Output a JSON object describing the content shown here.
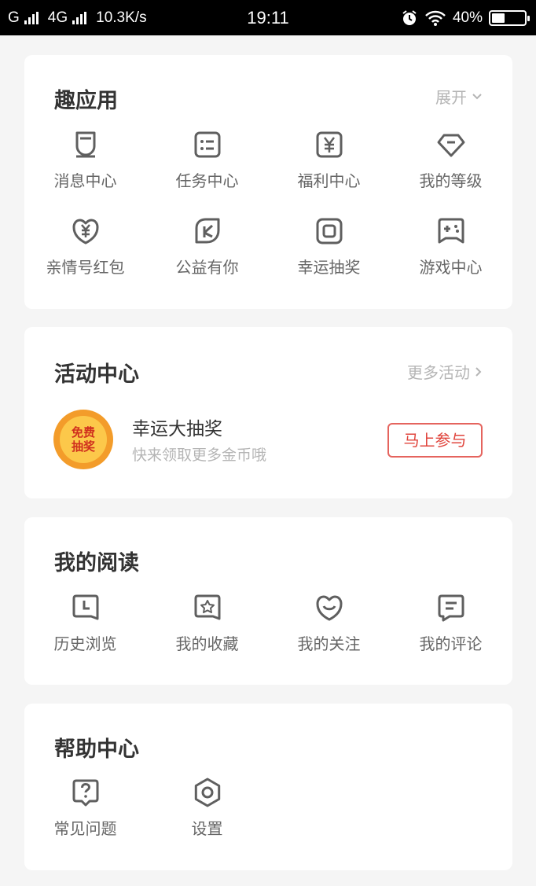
{
  "status_bar": {
    "signal1_label": "G",
    "signal2_label": "4G",
    "net_speed": "10.3K/s",
    "time": "19:11",
    "battery": "40%",
    "battery_level": 0.4,
    "icons": [
      "signal-bars-icon",
      "alarm-icon",
      "wifi-icon",
      "battery-icon"
    ]
  },
  "fun_apps": {
    "title": "趣应用",
    "expand_label": "展开",
    "items": [
      {
        "label": "消息中心",
        "icon": "bell-icon"
      },
      {
        "label": "任务中心",
        "icon": "task-list-icon"
      },
      {
        "label": "福利中心",
        "icon": "yuan-box-icon"
      },
      {
        "label": "我的等级",
        "icon": "diamond-icon"
      },
      {
        "label": "亲情号红包",
        "icon": "yuan-heart-icon"
      },
      {
        "label": "公益有你",
        "icon": "leaf-icon"
      },
      {
        "label": "幸运抽奖",
        "icon": "lucky-box-icon"
      },
      {
        "label": "游戏中心",
        "icon": "gamepad-icon"
      }
    ]
  },
  "activity": {
    "title": "活动中心",
    "more_label": "更多活动",
    "badge_line1": "免费",
    "badge_line2": "抽奖",
    "promo_title": "幸运大抽奖",
    "promo_subtitle": "快来领取更多金币哦",
    "join_label": "马上参与"
  },
  "reading": {
    "title": "我的阅读",
    "items": [
      {
        "label": "历史浏览",
        "icon": "clock-icon"
      },
      {
        "label": "我的收藏",
        "icon": "star-icon"
      },
      {
        "label": "我的关注",
        "icon": "smile-heart-icon"
      },
      {
        "label": "我的评论",
        "icon": "comment-icon"
      }
    ]
  },
  "help": {
    "title": "帮助中心",
    "items": [
      {
        "label": "常见问题",
        "icon": "question-icon"
      },
      {
        "label": "设置",
        "icon": "settings-icon"
      }
    ]
  },
  "colors": {
    "accent_red": "#e0443c",
    "icon_gray": "#5f5f5f",
    "muted_text": "#b5b5b5",
    "badge_orange": "#f39c2a"
  }
}
